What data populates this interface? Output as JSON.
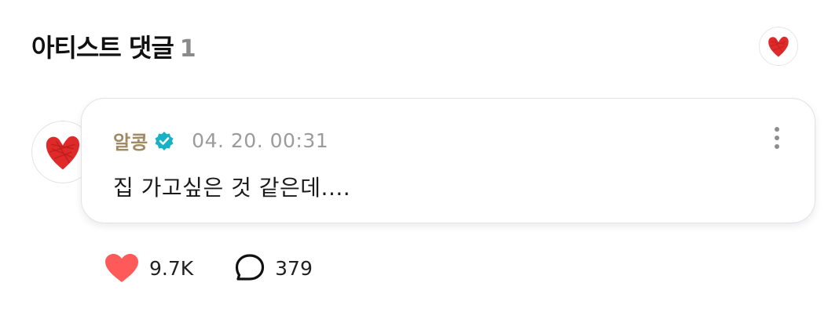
{
  "header": {
    "title": "아티스트 댓글",
    "count": "1",
    "avatar_icon": "heart-doodle-icon"
  },
  "comment": {
    "author": "알콩",
    "verified_icon": "verified-badge-icon",
    "timestamp": "04. 20. 00:31",
    "text": "집 가고싶은 것 같은데....",
    "more_icon": "more-vertical-icon"
  },
  "actions": {
    "like_count": "9.7K",
    "like_icon": "heart-icon",
    "reply_count": "379",
    "reply_icon": "speech-bubble-icon"
  },
  "colors": {
    "author_name": "#a08a62",
    "verified": "#17b3c4",
    "like": "#ff5a5a",
    "timestamp": "#9b9b9b",
    "count_badge": "#8a8a8a"
  }
}
